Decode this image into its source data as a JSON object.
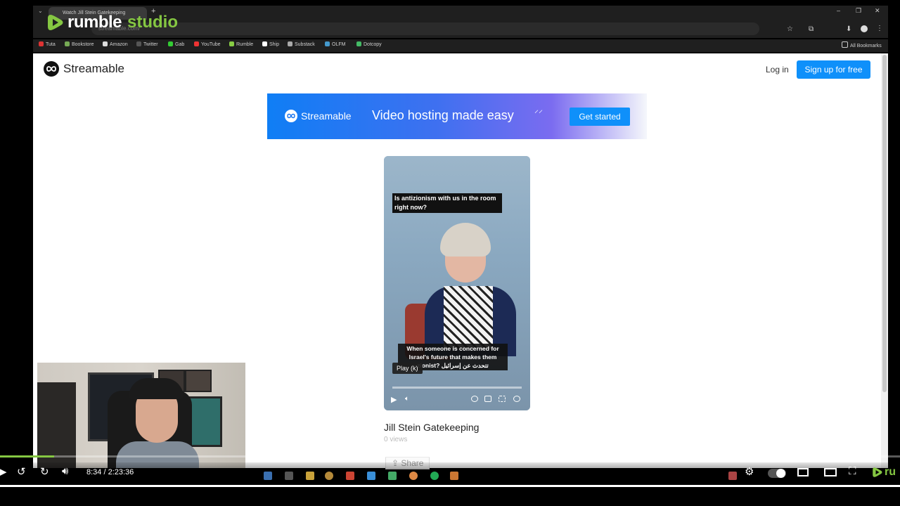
{
  "overlay": {
    "brand_primary": "rumble",
    "brand_secondary": "studio",
    "accent_color": "#85c742"
  },
  "browser": {
    "tab_title": "Watch Jill Stein Gatekeeping",
    "address": "streamable.com/",
    "bookmarks": [
      {
        "label": "Tuta",
        "color": "#d33"
      },
      {
        "label": "Bookstore",
        "color": "#7a5"
      },
      {
        "label": "Amazon",
        "color": "#ddd"
      },
      {
        "label": "Twitter",
        "color": "#333"
      },
      {
        "label": "Gab",
        "color": "#3c3"
      },
      {
        "label": "YouTube",
        "color": "#e33"
      },
      {
        "label": "Rumble",
        "color": "#8c4"
      },
      {
        "label": "Ship",
        "color": "#fff"
      },
      {
        "label": "Substack",
        "color": "#aaa"
      },
      {
        "label": "OLFM",
        "color": "#49c"
      },
      {
        "label": "Dotcopy",
        "color": "#4b6"
      }
    ],
    "all_bookmarks": "All Bookmarks"
  },
  "page": {
    "logo_text": "Streamable",
    "login": "Log in",
    "signup": "Sign up for free",
    "banner": {
      "logo_text": "Streamable",
      "tagline": "Video hosting made easy",
      "cta": "Get started"
    },
    "video": {
      "caption_top": "Is antizionism with us in the room right now?",
      "caption_bottom": "When someone is concerned for Israel's future that makes them zionist? تتحدث عن إسرائيل",
      "play_tooltip": "Play (k)",
      "title": "Jill Stein Gatekeeping",
      "views": "0 views",
      "share": "Share"
    }
  },
  "player": {
    "time": "8:34 / 2:23:36",
    "progress_fraction": 0.06,
    "brand_short": "ru"
  }
}
